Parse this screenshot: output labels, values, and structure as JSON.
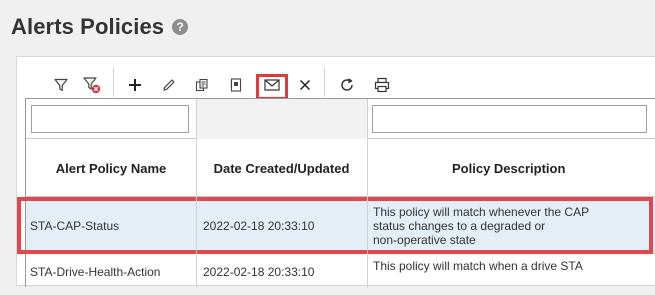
{
  "page": {
    "title": "Alerts Policies",
    "help_glyph": "?"
  },
  "toolbar": {
    "buttons": [
      {
        "name": "filter-icon"
      },
      {
        "name": "clear-filter-icon"
      },
      {
        "name": "add-icon"
      },
      {
        "name": "edit-icon"
      },
      {
        "name": "copy-icon"
      },
      {
        "name": "details-icon"
      },
      {
        "name": "email-icon"
      },
      {
        "name": "delete-icon"
      },
      {
        "name": "refresh-icon"
      },
      {
        "name": "print-icon"
      }
    ]
  },
  "table": {
    "filters": {
      "name": "",
      "date": "",
      "description": ""
    },
    "columns": [
      "Alert Policy Name",
      "Date Created/Updated",
      "Policy Description"
    ],
    "rows": [
      {
        "name": "STA-CAP-Status",
        "date": "2022-02-18 20:33:10",
        "description_lines": [
          "This policy will match whenever the CAP",
          "status changes to a degraded or",
          "non-operative state"
        ],
        "selected": true
      },
      {
        "name": "STA-Drive-Health-Action",
        "date": "2022-02-18 20:33:10",
        "description_lines": [
          "This policy will match when a drive STA"
        ],
        "selected": false
      }
    ]
  },
  "colors": {
    "highlight": "#e03a3a",
    "selected_row": "#e4eef7",
    "clear_filter_badge": "#d9363e"
  }
}
